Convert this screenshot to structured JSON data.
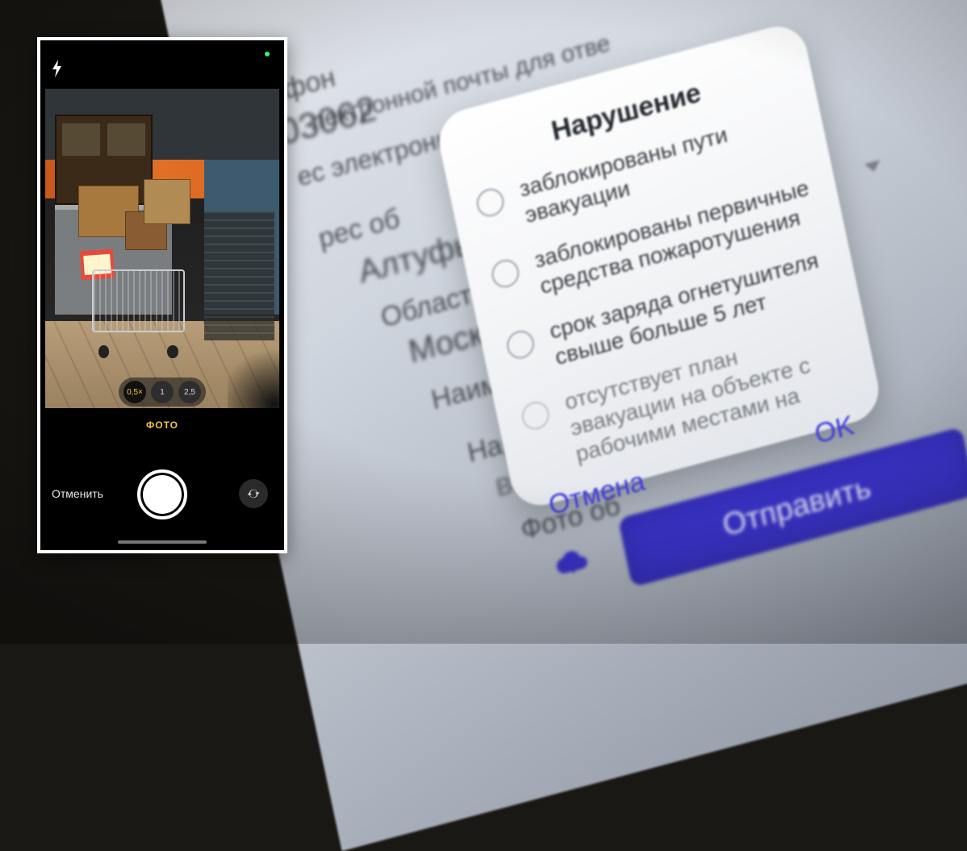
{
  "form": {
    "field_phone": "Телефон",
    "phone_fragment": "03062",
    "field_email_blur_a": "лектронной почты для отве",
    "field_email_blur_b": "ес электронной почты для ответа",
    "field_address_prefix": "рес об",
    "field_address_value": "Алтуфь",
    "field_region": "Область",
    "field_region_value": "Москва",
    "field_name": "Наимен",
    "field_violation": "Наруше",
    "field_violation_value": "выбери",
    "field_photo": "Фото об",
    "submit": "Отправить",
    "dropdown_caret": "▼"
  },
  "dialog": {
    "title": "Нарушение",
    "options": [
      "заблокированы пути эвакуации",
      "заблокированы первичные средства пожаротушения",
      "срок заряда огнетушителя свыше больше 5 лет",
      "отсутствует план эвакуации на объекте с рабочими местами на"
    ],
    "cancel": "Отмена",
    "ok": "OK"
  },
  "camera": {
    "mode": "ФОТО",
    "cancel": "Отменить",
    "zoom": [
      "0,5×",
      "1",
      "2,5"
    ]
  },
  "icons": {
    "flash": "flash-icon",
    "privacy_dot": "privacy-dot-icon",
    "shutter": "shutter-icon",
    "flip": "camera-flip-icon",
    "upload": "cloud-upload-icon",
    "caret": "chevron-down-icon"
  },
  "colors": {
    "accent": "#3e3bdf",
    "submit_bg": "#3a33c9",
    "camera_mode": "#f1c443"
  }
}
